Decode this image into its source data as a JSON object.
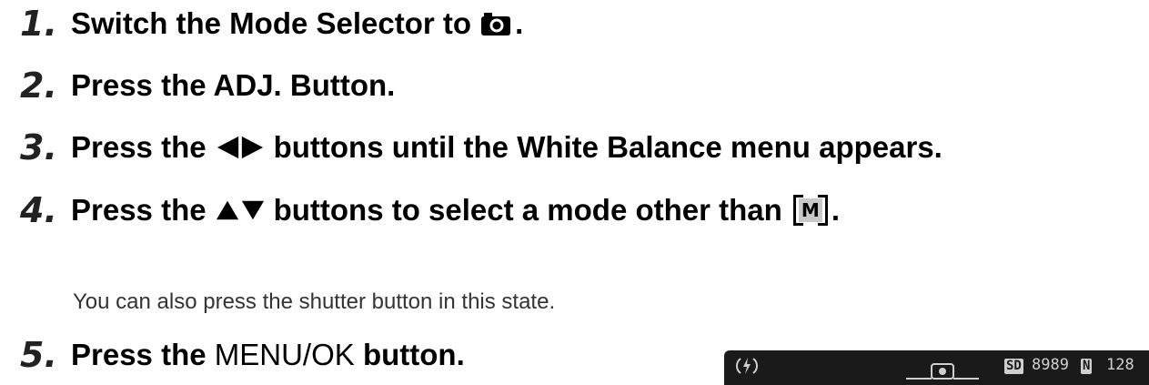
{
  "steps": [
    {
      "number": "1.",
      "text": "Switch the Mode Selector to",
      "suffix": "."
    },
    {
      "number": "2.",
      "text": "Press the ADJ. Button."
    },
    {
      "number": "3.",
      "text_before": "Press the",
      "text_after": "buttons until the White Balance menu appears."
    },
    {
      "number": "4.",
      "text_before": "Press the",
      "text_after": "buttons to select a mode other than",
      "mode_letter": "M",
      "suffix": "."
    },
    {
      "number": "5.",
      "text_before": "Press the",
      "button_name": "MENU/OK",
      "text_after": "button."
    }
  ],
  "note": "You can also press the shutter button in this state.",
  "lcd": {
    "sd_badge": "SD",
    "shots_remaining": "8989",
    "quality_badge": "N",
    "size_value": "128"
  },
  "icons": {
    "step1": "camera-icon",
    "step3": "left-right-arrows-icon",
    "step4": "up-down-arrows-icon",
    "step4_mode": "manual-white-balance-icon"
  }
}
